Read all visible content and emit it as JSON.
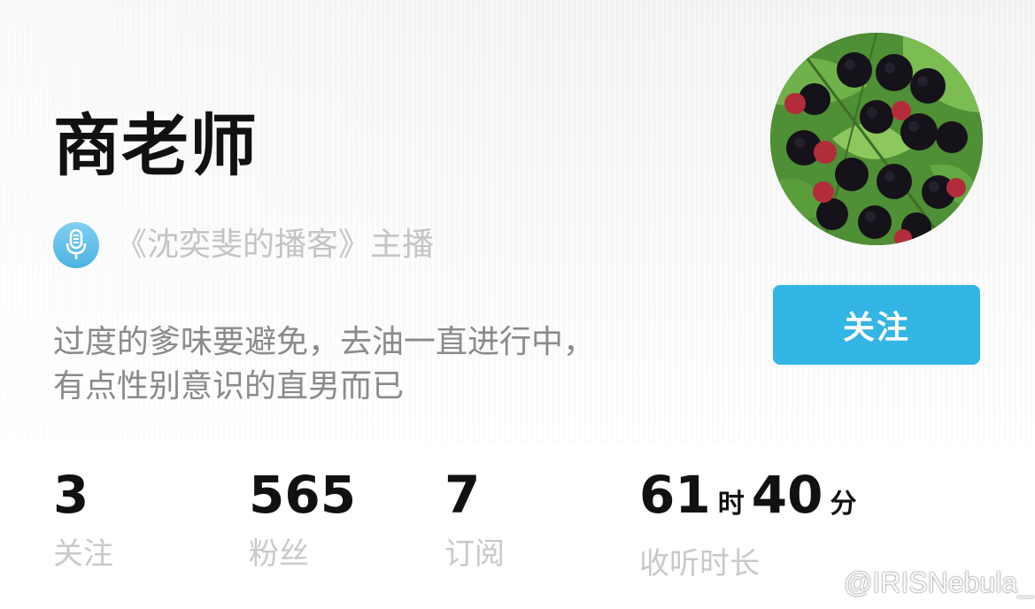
{
  "profile": {
    "name": "商老师",
    "podcast": "《沈奕斐的播客》主播",
    "bio": [
      "过度的爹味要避免，去油一直进行中，",
      "有点性别意识的直男而已"
    ],
    "follow_label": "关注"
  },
  "stats": [
    {
      "value": "3",
      "label": "关注"
    },
    {
      "value": "565",
      "label": "粉丝"
    },
    {
      "value": "7",
      "label": "订阅"
    }
  ],
  "listen_time": {
    "hours": "61",
    "hours_unit": "时",
    "minutes": "40",
    "minutes_unit": "分",
    "label": "收听时长"
  },
  "watermark": "@IRISNebula_",
  "colors": {
    "accent": "#33b5e5",
    "mic_icon": "#3aaee3"
  },
  "icons": {
    "podcast": "microphone-icon",
    "watermark": "weibo-icon",
    "avatar": "blackberry-photo"
  }
}
